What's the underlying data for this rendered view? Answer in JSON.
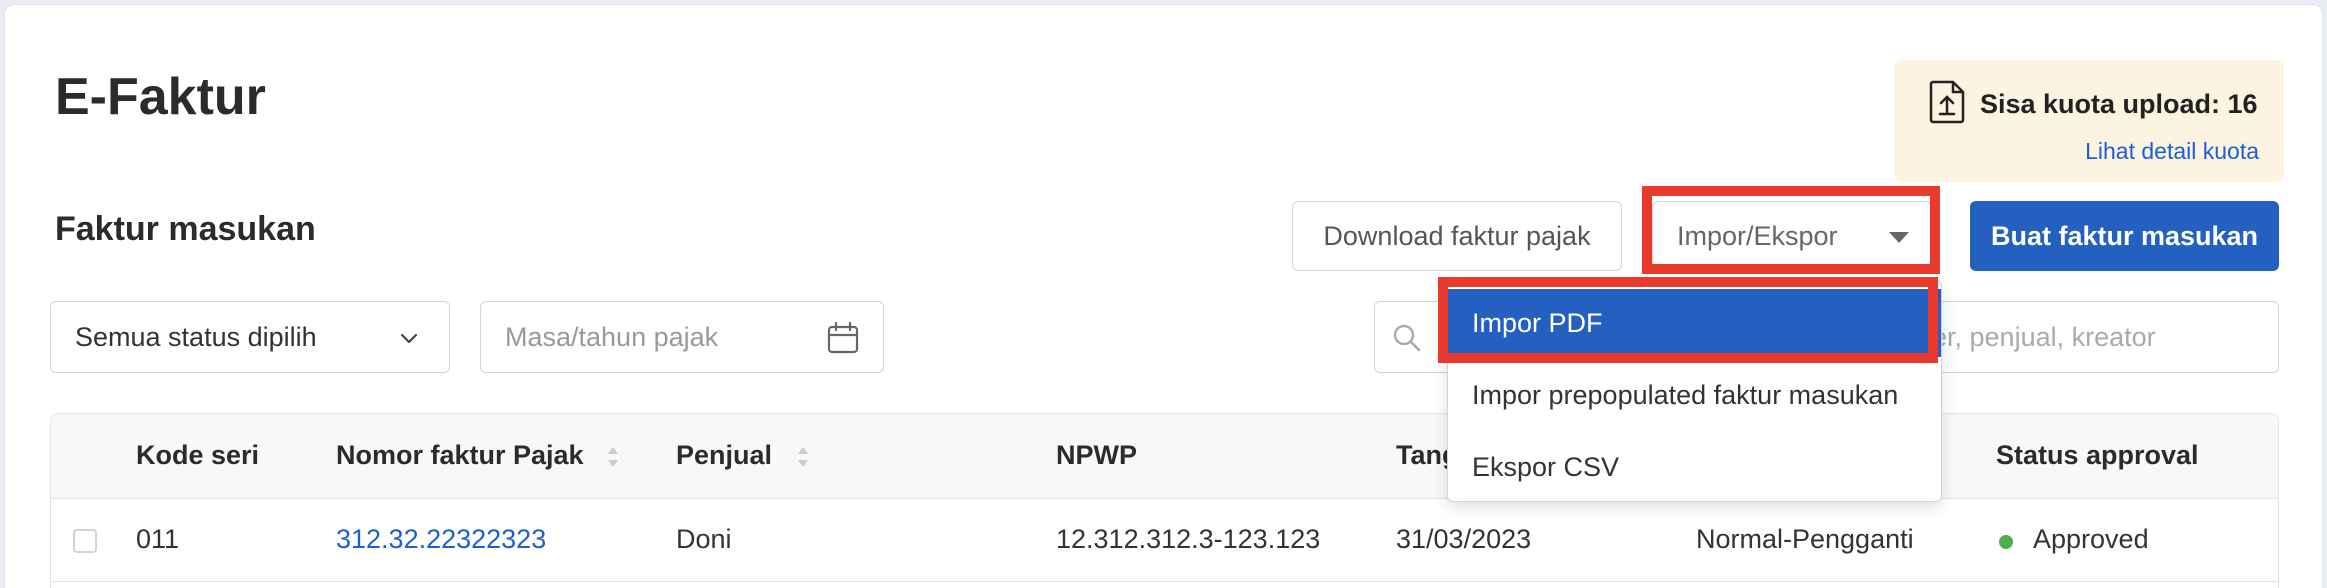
{
  "header": {
    "title": "E-Faktur"
  },
  "quota": {
    "text": "Sisa kuota upload: 16",
    "link": "Lihat detail kuota"
  },
  "section": {
    "title": "Faktur masukan"
  },
  "toolbar": {
    "download_label": "Download faktur pajak",
    "impor_label": "Impor/Ekspor",
    "create_label": "Buat faktur masukan"
  },
  "dropdown": {
    "items": [
      "Impor PDF",
      "Impor prepopulated faktur masukan",
      "Ekspor CSV"
    ]
  },
  "filters": {
    "status_value": "Semua status dipilih",
    "masa_placeholder": "Masa/tahun pajak",
    "search_placeholder": "lier, penjual, kreator"
  },
  "table": {
    "headers": [
      "Kode seri",
      "Nomor faktur Pajak",
      "Penjual",
      "NPWP",
      "Tang",
      "Status approval"
    ],
    "rows": [
      [
        "011",
        "312.32.22322323",
        "Doni",
        "12.312.312.3-123.123",
        "31/03/2023",
        "Normal-Pengganti",
        "Approved"
      ]
    ]
  },
  "colors": {
    "primary": "#2360bf",
    "highlight": "#e83b2d",
    "approved": "#4caf50",
    "quota_bg": "#fdf3e1"
  }
}
